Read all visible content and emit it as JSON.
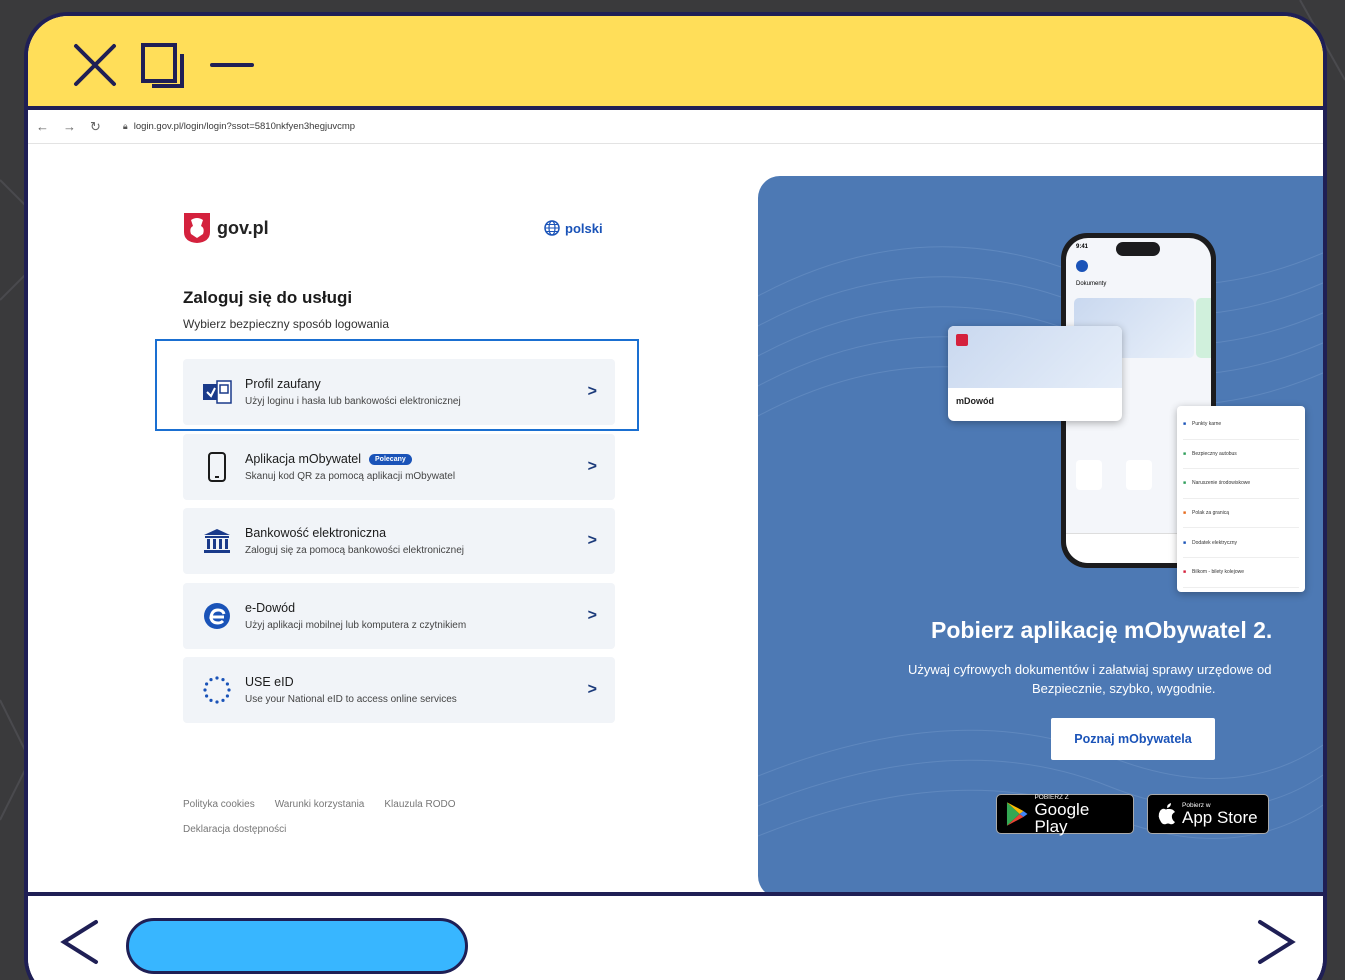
{
  "browser": {
    "url": "login.gov.pl/login/login?ssot=5810nkfyen3hegjuvcmp"
  },
  "login": {
    "brand": "gov.pl",
    "language": "polski",
    "title": "Zaloguj się do usługi",
    "subtitle": "Wybierz bezpieczny sposób logowania",
    "options": [
      {
        "title": "Profil zaufany",
        "desc": "Użyj loginu i hasła lub bankowości elektronicznej",
        "icon": "trusted-profile-icon"
      },
      {
        "title": "Aplikacja mObywatel",
        "badge": "Polecany",
        "desc": "Skanuj kod QR za pomocą aplikacji mObywatel",
        "icon": "phone-icon"
      },
      {
        "title": "Bankowość elektroniczna",
        "desc": "Zaloguj się za pomocą bankowości elektronicznej",
        "icon": "bank-icon"
      },
      {
        "title": "e-Dowód",
        "desc": "Użyj aplikacji mobilnej lub komputera z czytnikiem",
        "icon": "e-id-icon"
      },
      {
        "title": "USE eID",
        "desc": "Use your National eID to access online services",
        "icon": "eu-stars-icon"
      }
    ],
    "footer": {
      "cookies": "Polityka cookies",
      "terms": "Warunki korzystania",
      "rodo": "Klauzula RODO",
      "accessibility": "Deklaracja dostępności"
    }
  },
  "promo": {
    "title": "Pobierz aplikację mObywatel 2.",
    "line1": "Używaj cyfrowych dokumentów i załatwiaj sprawy urzędowe od",
    "line2": "Bezpiecznie, szybko, wygodnie.",
    "button": "Poznaj mObywatela",
    "google_small": "POBIERZ Z",
    "google_big": "Google Play",
    "apple_small": "Pobierz w",
    "apple_big": "App Store",
    "card_label": "mDowód",
    "phone_header": "Dokumenty",
    "phone_time": "9:41",
    "list_items": [
      "Punkty karne",
      "Bezpieczny autobus",
      "Naruszenie środowiskowe",
      "Polak za granicą",
      "Dodatek elektryczny",
      "Bilkom - bilety kolejowe"
    ]
  },
  "colors": {
    "titlebar": "#ffde59",
    "frame": "#1f1f55",
    "pill": "#38b6ff",
    "promo": "#4d79b4",
    "accent": "#1a53b8"
  }
}
